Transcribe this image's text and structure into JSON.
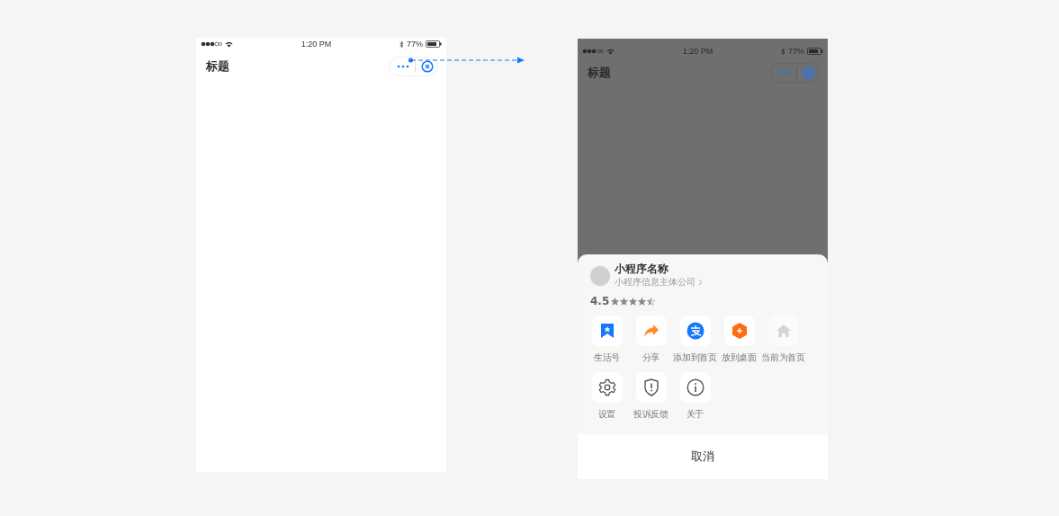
{
  "screens": [
    {
      "dimmed": false,
      "status_bar": {
        "time": "1:20 PM",
        "battery": "77%"
      },
      "nav": {
        "title": "标题"
      }
    },
    {
      "dimmed": true,
      "status_bar": {
        "time": "1:20 PM",
        "battery": "77%"
      },
      "nav": {
        "title": "标题"
      },
      "sheet": {
        "app_name": "小程序名称",
        "company": "小程序信息主体公司",
        "rating": "4.5",
        "stars": 4.5,
        "rows": [
          [
            {
              "label": "生活号",
              "disabled": false
            },
            {
              "label": "分享",
              "disabled": false
            },
            {
              "label": "添加到首页",
              "disabled": false
            },
            {
              "label": "放到桌面",
              "disabled": false
            },
            {
              "label": "当前为首页",
              "disabled": true
            }
          ],
          [
            {
              "label": "设置",
              "disabled": false
            },
            {
              "label": "投诉反馈",
              "disabled": false
            },
            {
              "label": "关于",
              "disabled": false
            }
          ]
        ],
        "cancel": "取消"
      }
    }
  ]
}
